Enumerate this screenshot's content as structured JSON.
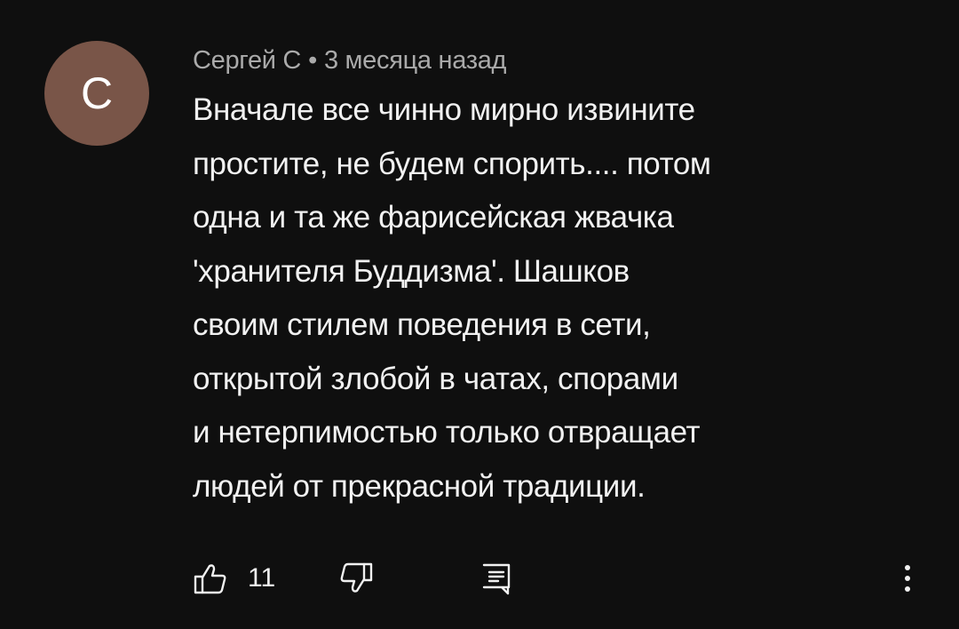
{
  "comment": {
    "avatar_letter": "С",
    "avatar_color": "#795548",
    "author": "Сергей С",
    "separator": "•",
    "time": "3 месяца назад",
    "text_lines": [
      "Вначале все чинно мирно извините",
      "простите, не будем спорить.... потом",
      "одна и та же фарисейская жвачка",
      "'хранителя Буддизма'. Шашков",
      "своим стилем поведения в сети,",
      "открытой злобой в чатах, спорами",
      "и нетерпимостью только отвращает",
      "людей от прекрасной традиции."
    ]
  },
  "actions": {
    "like_icon": "thumbs-up-icon",
    "like_count": "11",
    "dislike_icon": "thumbs-down-icon",
    "reply_icon": "comment-reply-icon",
    "more_icon": "more-vertical-icon"
  }
}
